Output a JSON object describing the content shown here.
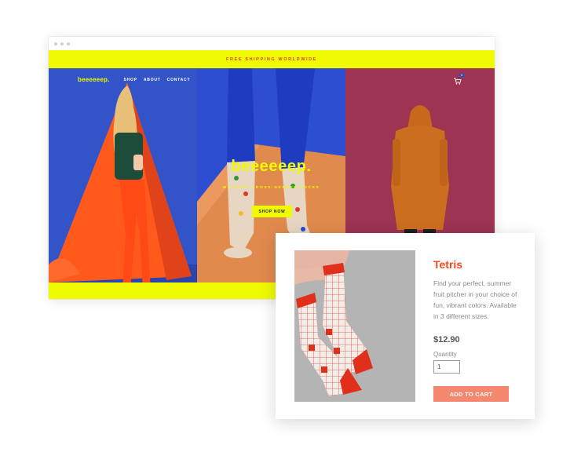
{
  "site": {
    "promo": "FREE SHIPPING WORLDWIDE",
    "logo": "beeeeeep.",
    "nav": [
      "SHOP",
      "ABOUT",
      "CONTACT"
    ],
    "cart_count": "0",
    "hero_title": "beeeeeep.",
    "hero_subtitle": "WE MAKE CROSS-GENDER SOCKS",
    "hero_button": "SHOP NOW"
  },
  "product": {
    "title": "Tetris",
    "description": "Find your perfect, summer fruit pitcher in your choice of fun, vibrant colors. Available in 3 different sizes.",
    "price": "$12.90",
    "quantity_label": "Quantity",
    "quantity_value": "1",
    "add_to_cart": "ADD TO CART"
  },
  "colors": {
    "accent_yellow": "#f0fa00",
    "accent_red": "#ee4b1e",
    "button_salmon": "#f5876e",
    "panel_blue": "#2f4fc8",
    "panel_maroon": "#9b3350"
  },
  "icons": [
    "cart-icon"
  ]
}
